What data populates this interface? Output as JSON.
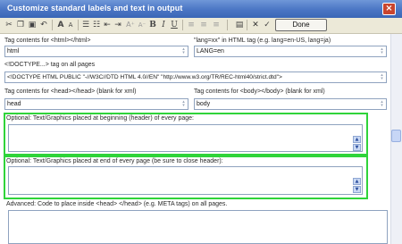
{
  "window": {
    "title": "Customize standard labels and text in output",
    "close_symbol": "×"
  },
  "toolbar": {
    "icons": [
      "scissors-icon",
      "copy-icon",
      "paste-icon",
      "undo-icon",
      "font-a-icon",
      "font-a-small-icon",
      "bulleted-list-icon",
      "numbered-list-icon",
      "outdent-icon",
      "indent-icon",
      "font-size-up-icon",
      "font-size-down-icon",
      "bold-icon",
      "italic-icon",
      "underline-icon",
      "align-left-icon",
      "align-center-icon",
      "align-right-icon",
      "remove-format-icon",
      "spellcheck-icon"
    ],
    "done_label": "Done"
  },
  "fields": {
    "html_tag_label": "Tag contents for <html></html>",
    "html_tag_value": "html",
    "lang_label": "\"lang=xx\" in HTML tag (e.g. lang=en-US, lang=ja)",
    "lang_value": "LANG=en",
    "doctype_label": "<!DOCTYPE...> tag on all pages",
    "doctype_value": "<!DOCTYPE HTML PUBLIC \"-//W3C//DTD HTML 4.0//EN\" \"http://www.w3.org/TR/REC-html40/strict.dtd\">",
    "head_tag_label": "Tag contents for <head></head> (blank for xml)",
    "head_tag_value": "head",
    "body_tag_label": "Tag contents for <body></body> (blank for xml)",
    "body_tag_value": "body",
    "header_label": "Optional: Text/Graphics placed at beginning (header) of every page:",
    "footer_label": "Optional: Text/Graphics placed at end of every page (be sure to close header):",
    "advanced_label": "Advanced: Code to place inside <head> </head> (e.g. META tags) on all pages."
  },
  "colors": {
    "highlight": "#2fd43a",
    "titlebar": "#4a75c4"
  }
}
